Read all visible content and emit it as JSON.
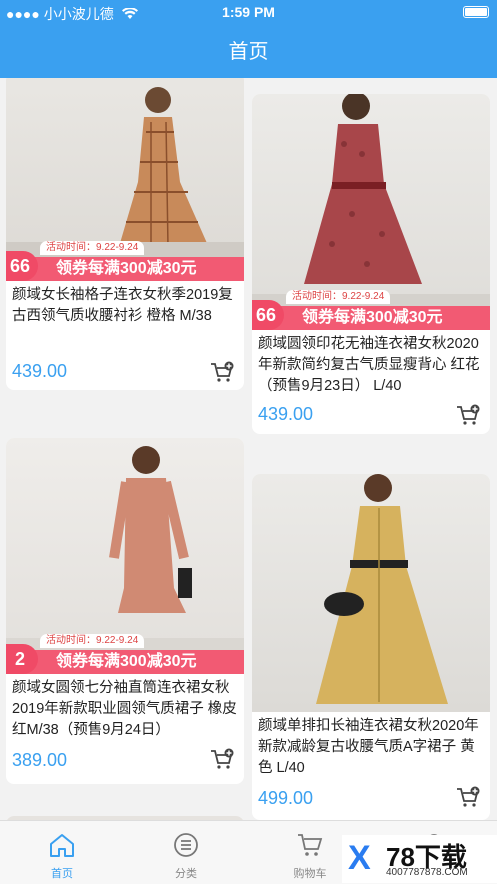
{
  "status_bar": {
    "carrier": "小小波儿德",
    "time": "1:59 PM"
  },
  "header": {
    "title": "首页"
  },
  "promo": {
    "time_text": "活动时间：9.22-9.24",
    "coupon_text": "领券每满300减30元"
  },
  "products": [
    {
      "badge": "66",
      "title": "颜域女长袖格子连衣女秋季2019复古西领气质收腰衬衫 橙格 M/38",
      "price": "439.00"
    },
    {
      "badge": "66",
      "title": "颜域圆领印花无袖连衣裙女秋2020年新款简约复古气质显瘦背心 红花（预售9月23日） L/40",
      "price": "439.00"
    },
    {
      "badge": "2",
      "title": "颜域女圆领七分袖直筒连衣裙女秋2019年新款职业圆领气质裙子 橡皮红M/38（预售9月24日）",
      "price": "389.00"
    },
    {
      "badge": "",
      "title": "颜域单排扣长袖连衣裙女秋2020年新款减龄复古收腰气质A字裙子 黄色 L/40",
      "price": "499.00"
    }
  ],
  "tabs": [
    {
      "label": "首页",
      "icon": "home-icon",
      "active": true
    },
    {
      "label": "分类",
      "icon": "category-icon",
      "active": false
    },
    {
      "label": "购物车",
      "icon": "cart-icon",
      "active": false
    },
    {
      "label": "",
      "icon": "profile-icon",
      "active": false
    }
  ],
  "watermark": {
    "logo": "78下载",
    "url": "4007787878.COM"
  },
  "colors": {
    "accent": "#3aa0f0",
    "promo": "#f25a73"
  }
}
